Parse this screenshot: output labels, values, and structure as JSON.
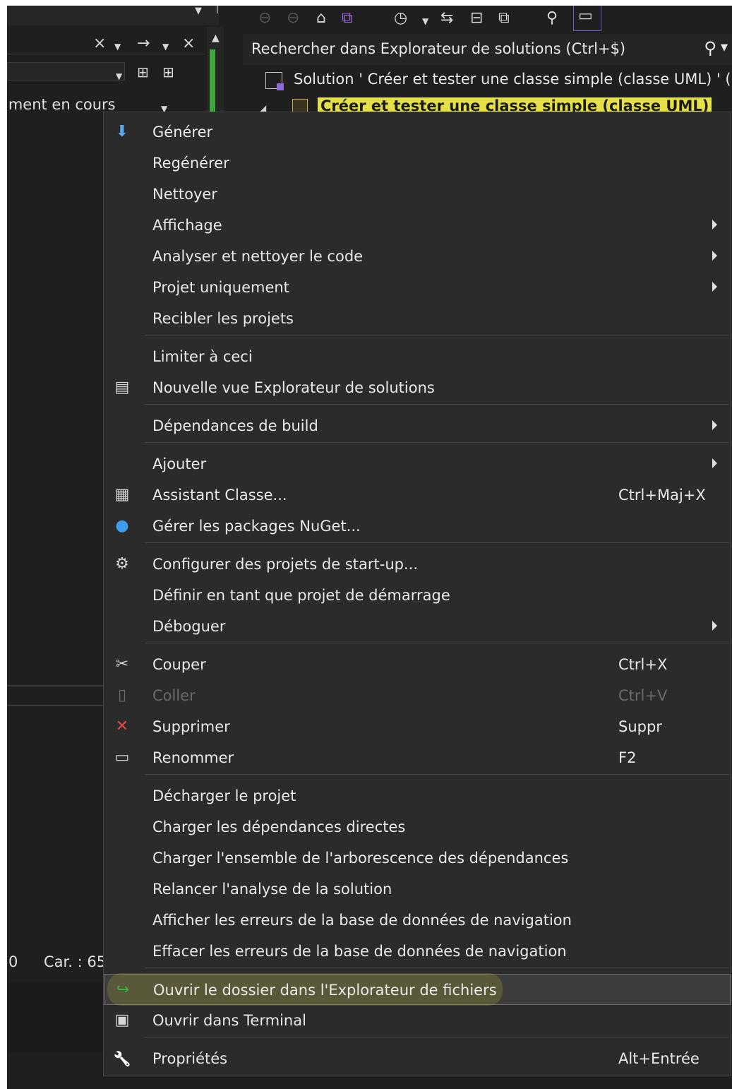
{
  "left_panel": {
    "tab_close": "×",
    "arrow": "→",
    "close2": "×",
    "document_label": "iment en cours",
    "status_zero": "0",
    "status_char": "Car. : 65"
  },
  "solution_explorer": {
    "search_placeholder": "Rechercher dans Explorateur de solutions (Ctrl+$)",
    "solution_label": "Solution ' Créer et tester une classe simple (classe UML) ' ('",
    "project_label": "Créer et tester une classe simple (classe UML)"
  },
  "menu": {
    "items": [
      {
        "label": "Générer",
        "icon": "build-icon"
      },
      {
        "label": "Regénérer"
      },
      {
        "label": "Nettoyer"
      },
      {
        "label": "Affichage",
        "submenu": true
      },
      {
        "label": "Analyser et nettoyer le code",
        "submenu": true
      },
      {
        "label": "Projet uniquement",
        "submenu": true
      },
      {
        "label": "Recibler les projets"
      },
      {
        "label": "Limiter à ceci"
      },
      {
        "label": "Nouvelle vue Explorateur de solutions",
        "icon": "new-view-icon"
      },
      {
        "label": "Dépendances de build",
        "submenu": true
      },
      {
        "label": "Ajouter",
        "submenu": true
      },
      {
        "label": "Assistant Classe...",
        "shortcut": "Ctrl+Maj+X",
        "icon": "class-wizard-icon"
      },
      {
        "label": "Gérer les packages NuGet...",
        "icon": "nuget-icon"
      },
      {
        "label": "Configurer des projets de start-up...",
        "icon": "gear-icon"
      },
      {
        "label": "Définir en tant que projet de démarrage"
      },
      {
        "label": "Déboguer",
        "submenu": true
      },
      {
        "label": "Couper",
        "shortcut": "Ctrl+X",
        "icon": "scissors-icon"
      },
      {
        "label": "Coller",
        "shortcut": "Ctrl+V",
        "icon": "paste-icon",
        "disabled": true
      },
      {
        "label": "Supprimer",
        "shortcut": "Suppr",
        "icon": "delete-icon"
      },
      {
        "label": "Renommer",
        "shortcut": "F2",
        "icon": "rename-icon"
      },
      {
        "label": "Décharger le projet"
      },
      {
        "label": "Charger les dépendances directes"
      },
      {
        "label": "Charger l'ensemble de l'arborescence des dépendances"
      },
      {
        "label": "Relancer l'analyse de la solution"
      },
      {
        "label": "Afficher les erreurs de la base de données de navigation"
      },
      {
        "label": "Effacer les erreurs de la base de données de navigation"
      },
      {
        "label": "Ouvrir le dossier dans l'Explorateur de fichiers",
        "icon": "open-folder-arrow-icon",
        "selected": true
      },
      {
        "label": "Ouvrir dans Terminal",
        "icon": "terminal-icon"
      },
      {
        "label": "Propriétés",
        "shortcut": "Alt+Entrée",
        "icon": "wrench-icon"
      }
    ]
  }
}
